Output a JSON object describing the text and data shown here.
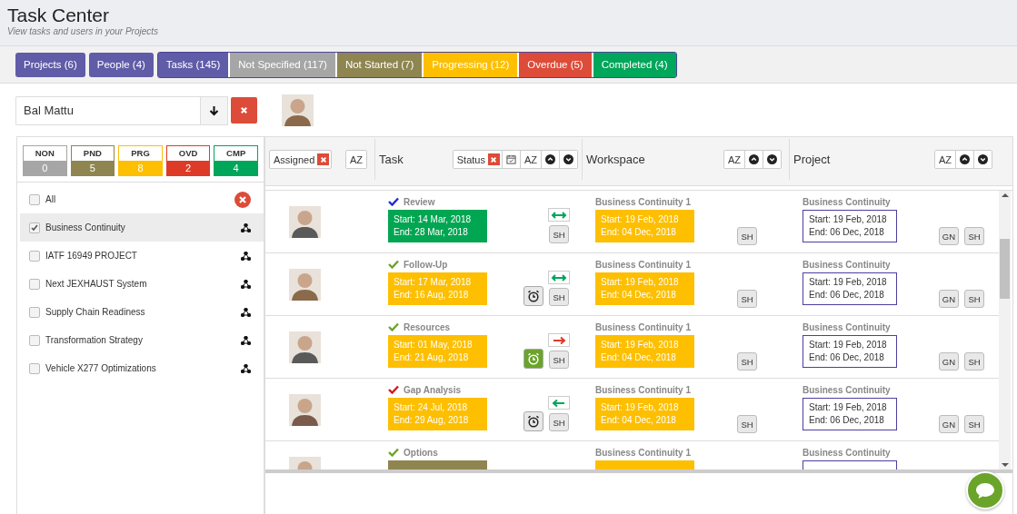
{
  "header": {
    "title": "Task Center",
    "subtitle": "View tasks and users in your Projects"
  },
  "filters": [
    {
      "label": "Projects (6)",
      "kind": "nav",
      "color": "#605ca8"
    },
    {
      "label": "People (4)",
      "kind": "nav",
      "color": "#605ca8"
    },
    {
      "label": "Tasks (145)",
      "kind": "group",
      "color": "#605ca8"
    },
    {
      "label": "Not Specified (117)",
      "kind": "group",
      "color": "#a6a6a6"
    },
    {
      "label": "Not Started (7)",
      "kind": "group",
      "color": "#8e8551"
    },
    {
      "label": "Progressing (12)",
      "kind": "group",
      "color": "#fdbf00"
    },
    {
      "label": "Overdue (5)",
      "kind": "group",
      "color": "#dd4b39"
    },
    {
      "label": "Completed (4)",
      "kind": "group",
      "color": "#00a65a"
    }
  ],
  "person_search": {
    "value": "Bal Mattu"
  },
  "status_counts": [
    {
      "label": "NON",
      "count": "0",
      "color": "#a6a6a6"
    },
    {
      "label": "PND",
      "count": "5",
      "color": "#8e8551"
    },
    {
      "label": "PRG",
      "count": "8",
      "color": "#fdbf00"
    },
    {
      "label": "OVD",
      "count": "2",
      "color": "#dd3b27"
    },
    {
      "label": "CMP",
      "count": "4",
      "color": "#00a65a"
    }
  ],
  "projects": [
    {
      "label": "All",
      "kind": "all",
      "checked": false,
      "selected": false
    },
    {
      "label": "Business Continuity",
      "kind": "project",
      "checked": true,
      "selected": true
    },
    {
      "label": "IATF 16949 PROJECT",
      "kind": "project",
      "checked": false,
      "selected": false
    },
    {
      "label": "Next JEXHAUST System",
      "kind": "project",
      "checked": false,
      "selected": false
    },
    {
      "label": "Supply Chain Readiness",
      "kind": "project",
      "checked": false,
      "selected": false
    },
    {
      "label": "Transformation Strategy",
      "kind": "project",
      "checked": false,
      "selected": false
    },
    {
      "label": "Vehicle X277 Optimizations",
      "kind": "project",
      "checked": false,
      "selected": false
    }
  ],
  "table": {
    "columns": [
      {
        "kind": "assigned",
        "filter": "Assigned",
        "buttons": [
          {
            "kind": "sort",
            "label": "AZ"
          }
        ]
      },
      {
        "kind": "task",
        "title": "Task",
        "filter": "Status",
        "buttons": [
          {
            "kind": "calendar"
          },
          {
            "kind": "sort",
            "label": "AZ"
          },
          {
            "kind": "up"
          },
          {
            "kind": "down"
          }
        ]
      },
      {
        "kind": "workspace",
        "title": "Workspace",
        "buttons": [
          {
            "kind": "sort",
            "label": "AZ"
          },
          {
            "kind": "up"
          },
          {
            "kind": "down"
          }
        ]
      },
      {
        "kind": "project",
        "title": "Project",
        "buttons": [
          {
            "kind": "sort",
            "label": "AZ"
          },
          {
            "kind": "up"
          },
          {
            "kind": "down"
          }
        ]
      }
    ],
    "rows": [
      {
        "task": {
          "name": "Review",
          "check": {
            "color": "#1c2bd9"
          },
          "dates": {
            "color": "#00a651",
            "start": "Start: 14 Mar, 2018",
            "end": "End: 28 Mar, 2018"
          },
          "arrow": {
            "kind": "both",
            "color": "#00a65a"
          },
          "share": "SH"
        },
        "workspace": {
          "name": "Business Continuity 1",
          "dates": {
            "color": "#fdbf00",
            "start": "Start: 19 Feb, 2018",
            "end": "End: 04 Dec, 2018"
          },
          "share": "SH"
        },
        "project": {
          "name": "Business Continuity",
          "start": "Start: 19 Feb, 2018",
          "end": "End: 06 Dec, 2018",
          "buttons": [
            "GN",
            "SH"
          ]
        }
      },
      {
        "task": {
          "name": "Follow-Up",
          "check": {
            "color": "#6aa42a"
          },
          "dates": {
            "color": "#fdbf00",
            "start": "Start: 17 Mar, 2018",
            "end": "End: 16 Aug, 2018"
          },
          "arrow": {
            "kind": "both",
            "color": "#00a65a"
          },
          "alarm": {
            "active": false
          },
          "share": "SH"
        },
        "workspace": {
          "name": "Business Continuity 1",
          "dates": {
            "color": "#fdbf00",
            "start": "Start: 19 Feb, 2018",
            "end": "End: 04 Dec, 2018"
          },
          "share": "SH"
        },
        "project": {
          "name": "Business Continuity",
          "start": "Start: 19 Feb, 2018",
          "end": "End: 06 Dec, 2018",
          "buttons": [
            "GN",
            "SH"
          ]
        }
      },
      {
        "task": {
          "name": "Resources",
          "check": {
            "color": "#6aa42a"
          },
          "dates": {
            "color": "#fdbf00",
            "start": "Start: 01 May, 2018",
            "end": "End: 21 Aug, 2018"
          },
          "arrow": {
            "kind": "right",
            "color": "#dd3b27"
          },
          "alarm": {
            "active": true
          },
          "share": "SH"
        },
        "workspace": {
          "name": "Business Continuity 1",
          "dates": {
            "color": "#fdbf00",
            "start": "Start: 19 Feb, 2018",
            "end": "End: 04 Dec, 2018"
          },
          "share": "SH"
        },
        "project": {
          "name": "Business Continuity",
          "start": "Start: 19 Feb, 2018",
          "end": "End: 06 Dec, 2018",
          "buttons": [
            "GN",
            "SH"
          ]
        }
      },
      {
        "task": {
          "name": "Gap Analysis",
          "check": {
            "color": "#d9141b"
          },
          "dates": {
            "color": "#fdbf00",
            "start": "Start: 24 Jul, 2018",
            "end": "End: 29 Aug, 2018"
          },
          "arrow": {
            "kind": "left",
            "color": "#00a65a"
          },
          "alarm": {
            "active": false
          },
          "share": "SH"
        },
        "workspace": {
          "name": "Business Continuity 1",
          "dates": {
            "color": "#fdbf00",
            "start": "Start: 19 Feb, 2018",
            "end": "End: 04 Dec, 2018"
          },
          "share": "SH"
        },
        "project": {
          "name": "Business Continuity",
          "start": "Start: 19 Feb, 2018",
          "end": "End: 06 Dec, 2018",
          "buttons": [
            "GN",
            "SH"
          ]
        }
      },
      {
        "task": {
          "name": "Options",
          "check": {
            "color": "#6aa42a"
          },
          "dates": {
            "color": "#8e8551"
          }
        },
        "workspace": {
          "name": "Business Continuity 1",
          "dates": {
            "color": "#fdbf00"
          }
        },
        "project": {
          "name": "Business Continuity"
        }
      }
    ]
  }
}
